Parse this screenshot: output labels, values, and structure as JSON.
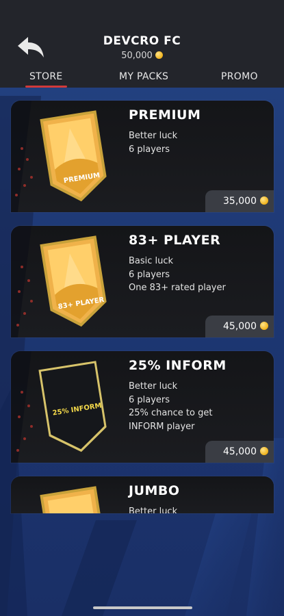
{
  "header": {
    "club_name": "DEVCRO FC",
    "coins": "50,000"
  },
  "tabs": [
    {
      "label": "STORE",
      "active": true
    },
    {
      "label": "MY PACKS",
      "active": false
    },
    {
      "label": "PROMO",
      "active": false
    }
  ],
  "packs": [
    {
      "title": "PREMIUM",
      "lines": [
        "Better luck",
        "6 players"
      ],
      "price": "35,000",
      "pack_label": "PREMIUM",
      "pack_style": "gold"
    },
    {
      "title": "83+ PLAYER",
      "lines": [
        "Basic luck",
        "6 players",
        "One 83+ rated player"
      ],
      "price": "45,000",
      "pack_label": "83+ PLAYER",
      "pack_style": "gold"
    },
    {
      "title": "25% INFORM",
      "lines": [
        "Better luck",
        "6 players",
        "25% chance to get",
        "INFORM player"
      ],
      "price": "45,000",
      "pack_label": "25% INFORM",
      "pack_style": "black"
    },
    {
      "title": "JUMBO",
      "lines": [
        "Better luck"
      ],
      "price": "",
      "pack_label": "",
      "pack_style": "gold"
    }
  ],
  "colors": {
    "accent_underline": "#d13a3a",
    "coin": "#f0b21a",
    "card_bg": "#17181c"
  }
}
